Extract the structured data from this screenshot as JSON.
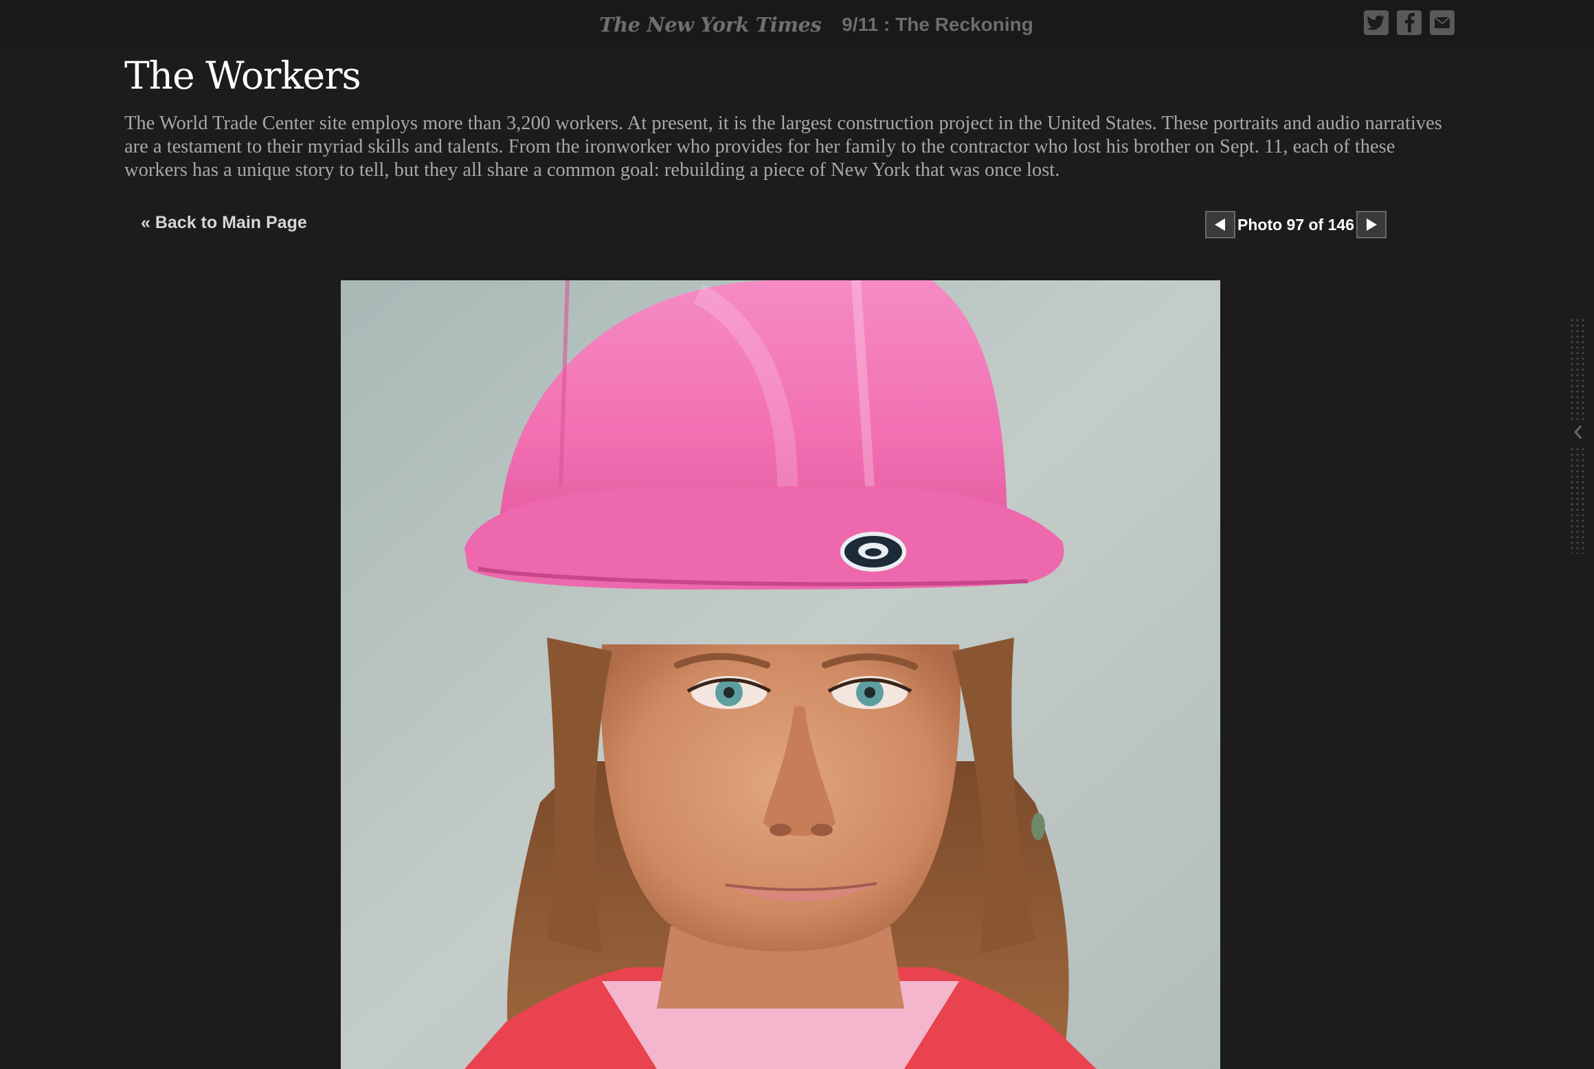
{
  "header": {
    "logo_text": "The New York Times",
    "section_title": "9/11 : The Reckoning",
    "share": [
      {
        "icon": "twitter-icon",
        "label": "Twitter"
      },
      {
        "icon": "facebook-icon",
        "label": "Facebook"
      },
      {
        "icon": "email-icon",
        "label": "Email"
      }
    ]
  },
  "article": {
    "title": "The Workers",
    "intro": "The World Trade Center site employs more than 3,200 workers. At present, it is the largest construction project in the United States. These portraits and audio narratives are a testament to their myriad skills and talents. From the ironworker who provides for her family to the contractor who lost his brother on Sept. 11, each of these workers has a unique story to tell, but they all share a common goal: rebuilding a piece of New York that was once lost."
  },
  "nav": {
    "back_label": "« Back to Main Page",
    "counter": "Photo 97 of 146",
    "current_photo": 97,
    "total_photos": 146,
    "prev_icon": "arrow-left-icon",
    "next_icon": "arrow-right-icon"
  },
  "photo": {
    "subject": "Portrait of a worker wearing a pink hard hat"
  },
  "sidebar": {
    "handle_icon": "chevron-left-icon"
  },
  "colors": {
    "background": "#1c1c1c",
    "hardhat_pink": "#f56fb4",
    "title_text": "#ffffff",
    "body_text": "#a8a8a8"
  }
}
